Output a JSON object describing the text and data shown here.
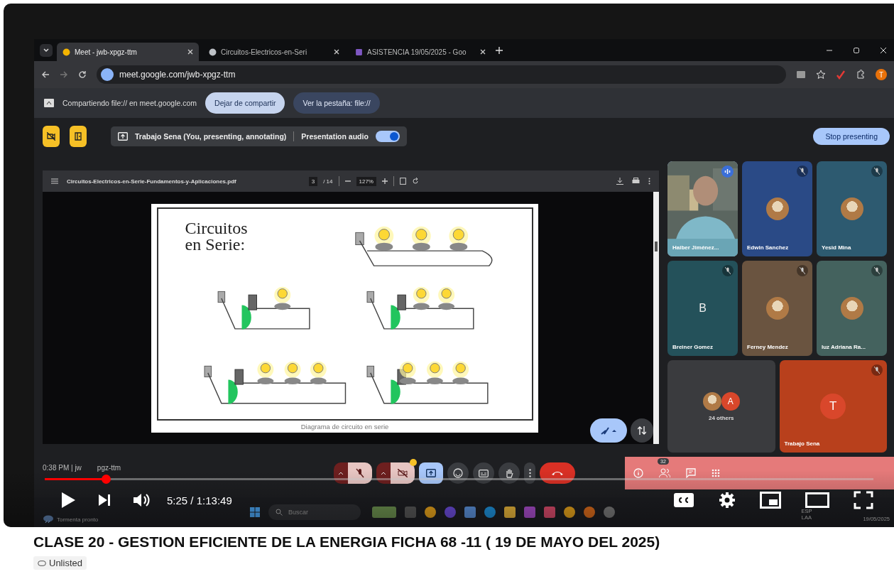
{
  "browser": {
    "tabs": [
      {
        "title": "Meet - jwb-xpgz-ttm",
        "selected": true,
        "kind": "meet"
      },
      {
        "title": "Circuitos-Electricos-en-Seri",
        "selected": false,
        "kind": "web"
      },
      {
        "title": "ASISTENCIA 19/05/2025 - Goo",
        "selected": false,
        "kind": "forms"
      }
    ],
    "url": "meet.google.com/jwb-xpgz-ttm",
    "profile_initial": "T"
  },
  "sharing_bar": {
    "message": "Compartiendo file:// en meet.google.com",
    "stop_button": "Dejar de compartir",
    "view_button": "Ver la pestaña: file://"
  },
  "meet": {
    "presenting_label": "Trabajo Sena (You, presenting, annotating)",
    "audio_label": "Presentation audio",
    "audio_on": true,
    "stop_button": "Stop presenting",
    "pdf": {
      "filename": "Circuitos-Electricos-en-Serie-Fundamentos-y-Aplicaciones.pdf",
      "page": "3",
      "page_count": "/ 14",
      "zoom": "127%",
      "slide_title": "Circuitos en Serie:",
      "caption": "Diagrama de circuito en serie"
    },
    "participants": [
      {
        "name": "Haiber Jiménez...",
        "kind": "video",
        "muted": false,
        "speaking": true,
        "selected": true
      },
      {
        "name": "Edwin Sanchez",
        "kind": "avatar",
        "muted": true,
        "speaking": false,
        "selected": false,
        "color": "#2a4a86"
      },
      {
        "name": "Yesid Mina",
        "kind": "avatar",
        "muted": true,
        "speaking": false,
        "selected": false,
        "color": "#2d5a70"
      },
      {
        "name": "Breiner Gomez",
        "kind": "letter",
        "initial": "B",
        "muted": true,
        "speaking": false,
        "selected": false,
        "color": "#24515a"
      },
      {
        "name": "Ferney Mendez",
        "kind": "avatar",
        "muted": true,
        "speaking": false,
        "selected": false,
        "color": "#6a5440"
      },
      {
        "name": "luz Adriana Ra...",
        "kind": "avatar",
        "muted": true,
        "speaking": false,
        "selected": false,
        "color": "#44625e"
      }
    ],
    "others": {
      "initial": "A",
      "label": "24 others"
    },
    "self": {
      "name": "Trabajo Sena",
      "initial": "T",
      "muted": true
    },
    "call_info": [
      "0:38 PM | jw",
      "pgz-ttm"
    ],
    "mic_on": false,
    "camera_on": false,
    "people_count": "32"
  },
  "taskbar": {
    "weather": "Tormenta pronto",
    "search_placeholder": "Buscar",
    "language": "ESP",
    "layout": "LAA",
    "date": "19/05/2025"
  },
  "player": {
    "level": 0.074,
    "time": "5:25 / 1:13:49"
  },
  "video": {
    "title": "CLASE 20 - GESTION EFICIENTE DE LA ENERGIA FICHA 68 -11 ( 19 DE MAYO DEL 2025)",
    "visibility": "Unlisted"
  }
}
